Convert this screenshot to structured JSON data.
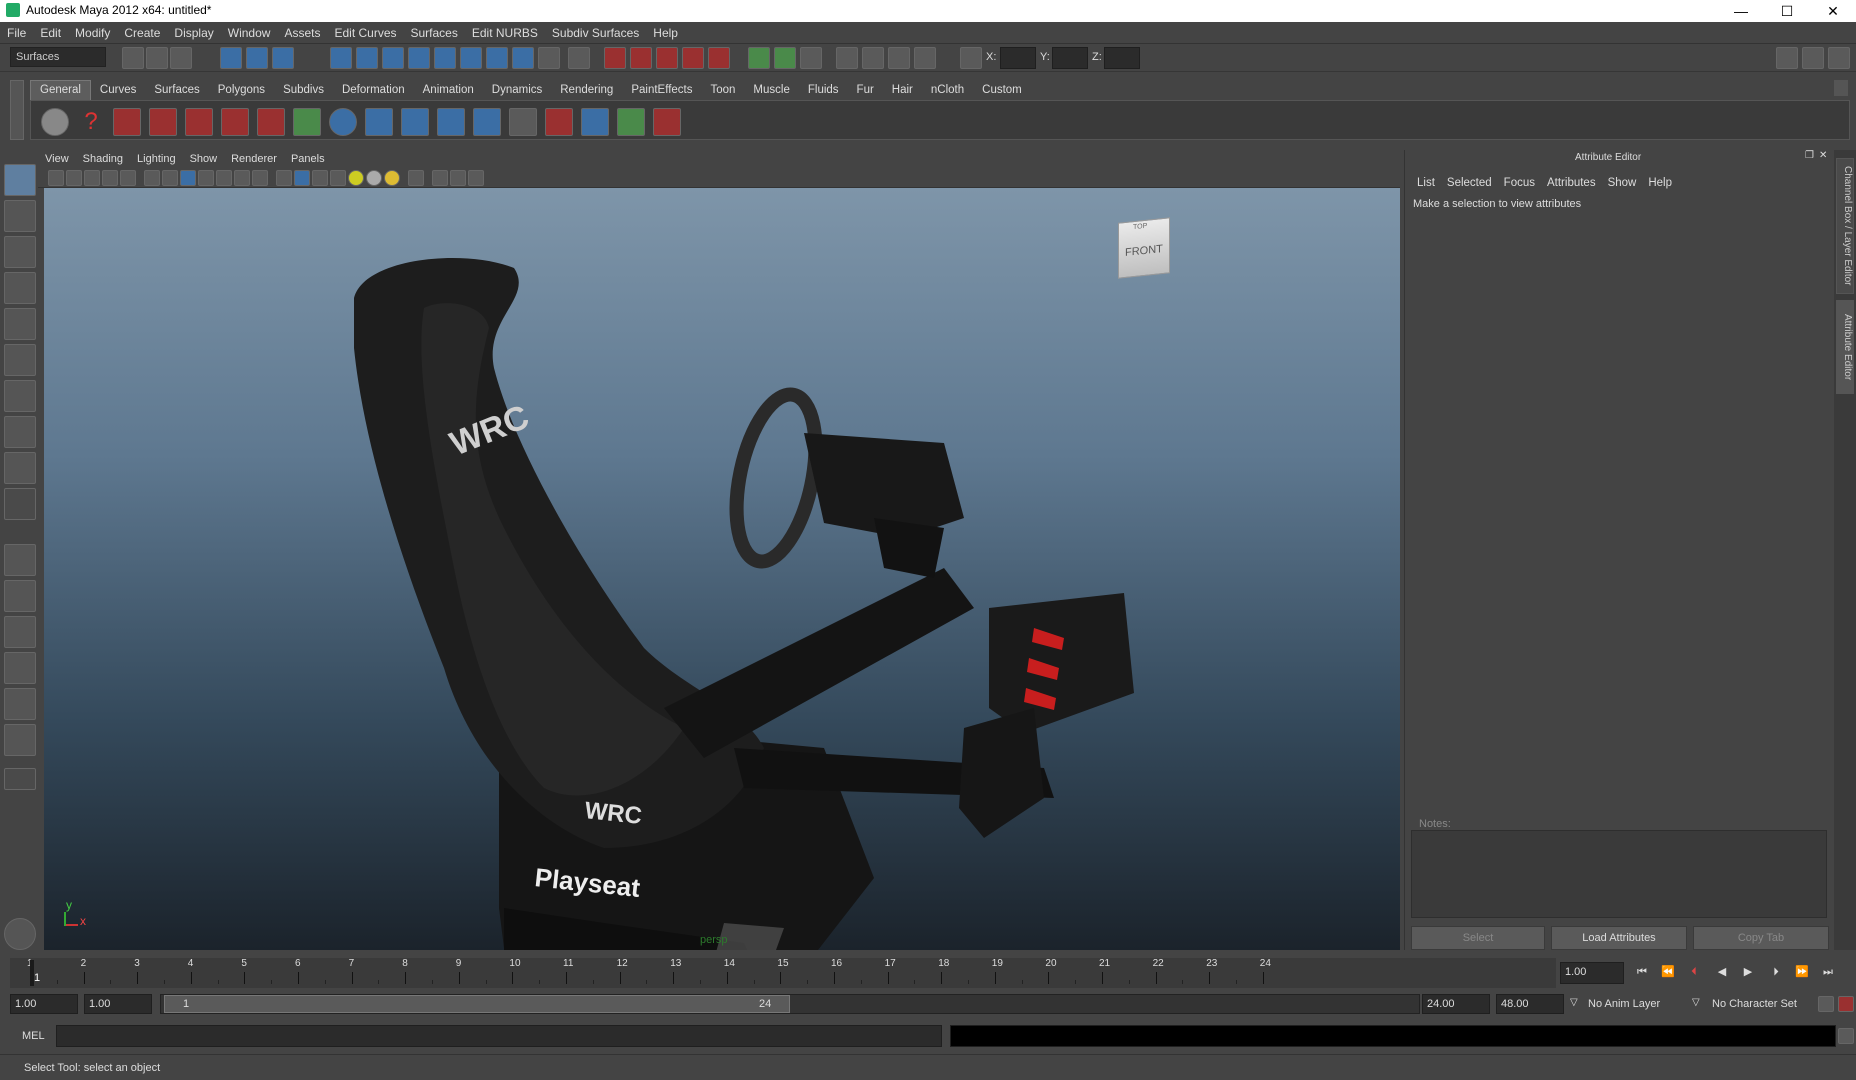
{
  "window": {
    "title": "Autodesk Maya 2012 x64: untitled*",
    "minimize": "—",
    "maximize": "☐",
    "close": "✕"
  },
  "menus": [
    "File",
    "Edit",
    "Modify",
    "Create",
    "Display",
    "Window",
    "Assets",
    "Edit Curves",
    "Surfaces",
    "Edit NURBS",
    "Subdiv Surfaces",
    "Help"
  ],
  "status": {
    "mode": "Surfaces",
    "x_label": "X:",
    "y_label": "Y:",
    "z_label": "Z:"
  },
  "shelf": {
    "tabs": [
      "General",
      "Curves",
      "Surfaces",
      "Polygons",
      "Subdivs",
      "Deformation",
      "Animation",
      "Dynamics",
      "Rendering",
      "PaintEffects",
      "Toon",
      "Muscle",
      "Fluids",
      "Fur",
      "Hair",
      "nCloth",
      "Custom"
    ],
    "active": "General"
  },
  "panel": {
    "menus": [
      "View",
      "Shading",
      "Lighting",
      "Show",
      "Renderer",
      "Panels"
    ],
    "camera": "persp",
    "viewcube": "FRONT",
    "viewcube_top": "TOP",
    "axis_y": "y",
    "axis_x": "x"
  },
  "scene": {
    "logo_back": "WRC",
    "logo_front": "WRC",
    "brand": "Playseat"
  },
  "attr": {
    "title": "Attribute Editor",
    "menus": [
      "List",
      "Selected",
      "Focus",
      "Attributes",
      "Show",
      "Help"
    ],
    "message": "Make a selection to view attributes",
    "notes_label": "Notes:",
    "btn_select": "Select",
    "btn_load": "Load Attributes",
    "btn_copy": "Copy Tab"
  },
  "sidebar": {
    "tab1": "Channel Box / Layer Editor",
    "tab2": "Attribute Editor"
  },
  "timeline": {
    "ticks": [
      "1",
      "2",
      "3",
      "4",
      "5",
      "6",
      "7",
      "8",
      "9",
      "10",
      "11",
      "12",
      "13",
      "14",
      "15",
      "16",
      "17",
      "18",
      "19",
      "20",
      "21",
      "22",
      "23",
      "24"
    ],
    "current": "1.00",
    "marker": "1"
  },
  "range": {
    "start": "1.00",
    "start2": "1.00",
    "slider_start": "1",
    "slider_end": "24",
    "end": "24.00",
    "end2": "48.00",
    "anim_layer": "No Anim Layer",
    "char_set": "No Character Set"
  },
  "cmd": {
    "label": "MEL",
    "help": "Select Tool: select an object"
  }
}
